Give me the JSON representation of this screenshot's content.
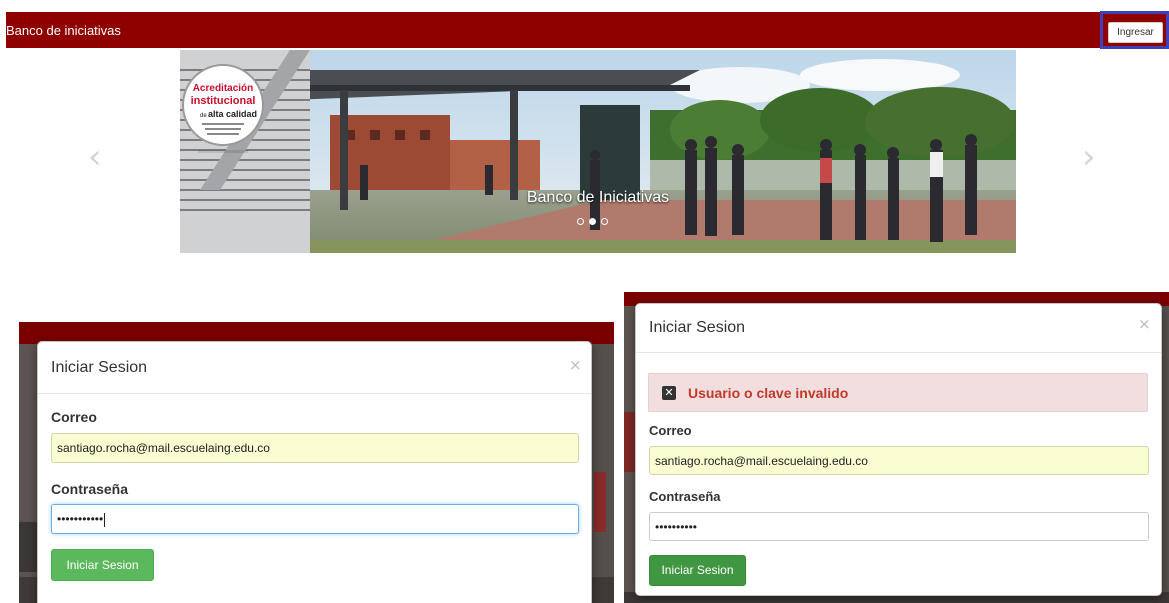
{
  "navbar": {
    "brand": "Banco de iniciativas",
    "login_button": "Ingresar",
    "bg_color": "#8f0000"
  },
  "carousel": {
    "caption": "Banco de Iniciativas",
    "badge": {
      "line1": "Acreditación",
      "line2": "institucional",
      "line3_prefix": "de",
      "line3": "alta calidad"
    },
    "prev_icon": "chevron-left-icon",
    "next_icon": "chevron-right-icon",
    "indicators": 3,
    "active_indicator": 1
  },
  "login_modal": {
    "title": "Iniciar Sesion",
    "close_icon": "close-icon",
    "email_label": "Correo",
    "email_value": "santiago.rocha@mail.escuelaing.edu.co",
    "password_label": "Contraseña",
    "password_value": "•••••••••••",
    "submit_label": "Iniciar Sesion"
  },
  "error_modal": {
    "title": "Iniciar Sesion",
    "close_icon": "close-icon",
    "alert_icon": "error-x-icon",
    "alert_text": "Usuario o clave invalido",
    "email_label": "Correo",
    "email_value": "santiago.rocha@mail.escuelaing.edu.co",
    "password_label": "Contraseña",
    "password_value": "••••••••••",
    "submit_label": "Iniciar Sesion"
  },
  "colors": {
    "brand_red": "#8f0000",
    "success_green": "#5cb85c",
    "alert_bg": "#f2dede",
    "alert_text": "#c0392b",
    "focus_blue": "#66afe9",
    "autofill_yellow": "#fafcd2"
  }
}
